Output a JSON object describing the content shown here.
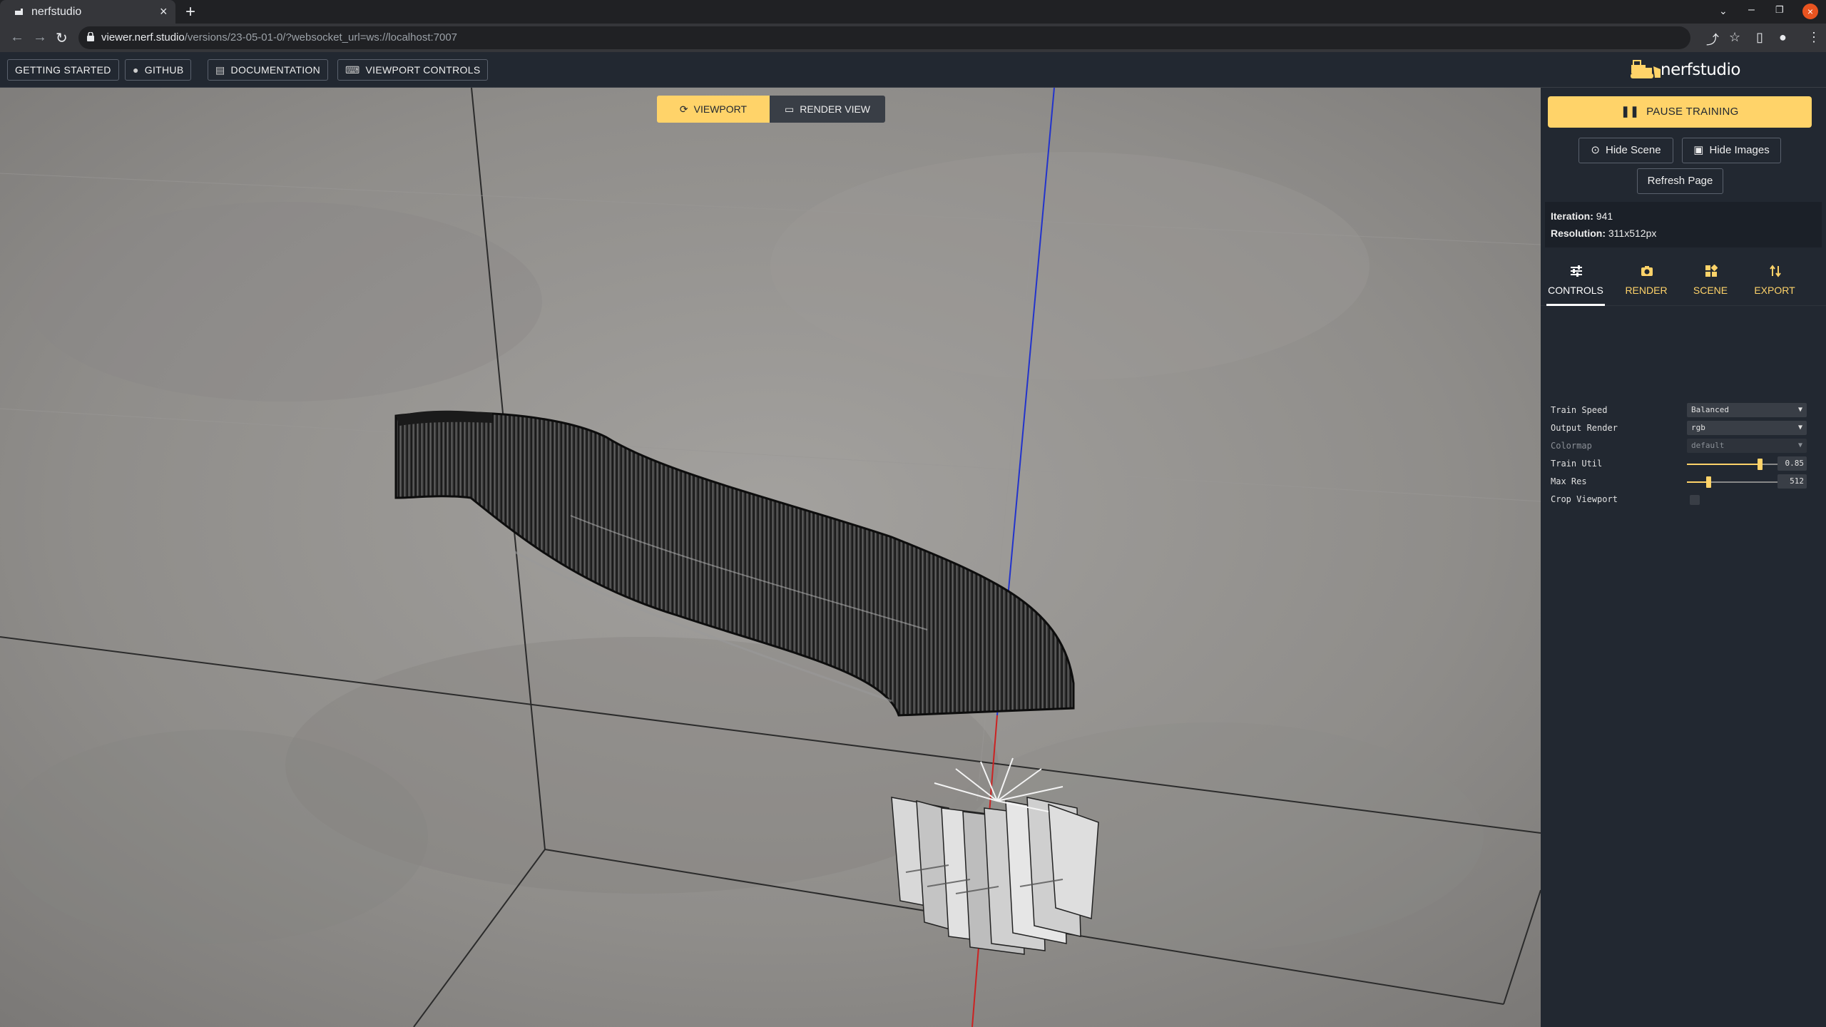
{
  "browser": {
    "tab_title": "nerfstudio",
    "url_host": "viewer.nerf.studio",
    "url_path": "/versions/23-05-01-0/?websocket_url=ws://localhost:7007"
  },
  "topbar": {
    "getting_started": "GETTING STARTED",
    "github": "GITHUB",
    "documentation": "DOCUMENTATION",
    "viewport_controls": "VIEWPORT CONTROLS",
    "logo": "nerfstudio"
  },
  "viewport": {
    "toggle_viewport": "VIEWPORT",
    "toggle_render": "RENDER VIEW"
  },
  "sidebar": {
    "pause": "PAUSE TRAINING",
    "hide_scene": "Hide Scene",
    "hide_images": "Hide Images",
    "refresh": "Refresh Page",
    "iteration_label": "Iteration:",
    "iteration_value": "941",
    "resolution_label": "Resolution:",
    "resolution_value": "311x512px",
    "tabs": [
      {
        "label": "CONTROLS"
      },
      {
        "label": "RENDER"
      },
      {
        "label": "SCENE"
      },
      {
        "label": "EXPORT"
      }
    ],
    "controls": {
      "train_speed_label": "Train Speed",
      "train_speed_value": "Balanced",
      "output_render_label": "Output Render",
      "output_render_value": "rgb",
      "colormap_label": "Colormap",
      "colormap_value": "default",
      "train_util_label": "Train Util",
      "train_util_value": "0.85",
      "max_res_label": "Max Res",
      "max_res_value": "512",
      "crop_viewport_label": "Crop Viewport"
    }
  },
  "colors": {
    "accent": "#ffd369",
    "panel": "#222831",
    "button_dark": "#393e46"
  }
}
